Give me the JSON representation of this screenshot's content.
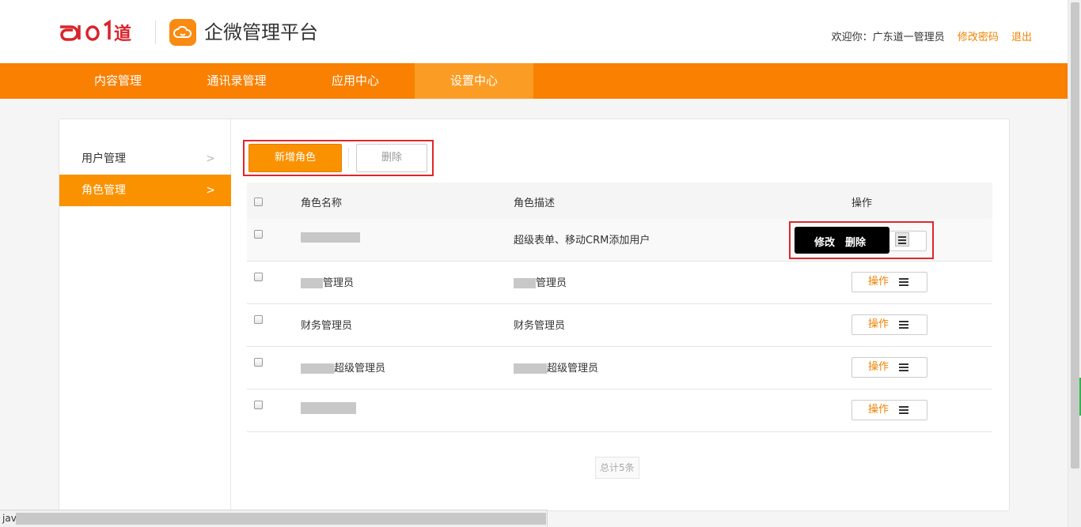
{
  "header": {
    "logo_text": "do1道",
    "app_title": "企微管理平台",
    "welcome": "欢迎你：广东道一管理员",
    "change_password": "修改密码",
    "logout": "退出"
  },
  "nav": {
    "tabs": [
      {
        "label": "内容管理"
      },
      {
        "label": "通讯录管理"
      },
      {
        "label": "应用中心"
      },
      {
        "label": "设置中心",
        "active": true
      }
    ]
  },
  "sidebar": {
    "items": [
      {
        "label": "用户管理",
        "active": false
      },
      {
        "label": "角色管理",
        "active": true
      }
    ]
  },
  "toolbar": {
    "add_label": "新增角色",
    "delete_label": "删除"
  },
  "table": {
    "headers": {
      "name": "角色名称",
      "desc": "角色描述",
      "op": "操作"
    },
    "rows": [
      {
        "name_suffix": "",
        "desc": "超级表单、移动CRM添加用户"
      },
      {
        "name_suffix": "管理员",
        "desc": "管理员"
      },
      {
        "name": "财务管理员",
        "desc": "财务管理员"
      },
      {
        "name_suffix": "超级管理员",
        "desc": "超级管理员"
      },
      {
        "name_suffix": "",
        "desc": ""
      }
    ],
    "op_label": "操作"
  },
  "popup": {
    "edit": "修改",
    "delete": "删除"
  },
  "footer": {
    "total": "总计5条"
  },
  "status_bar": {
    "text": "jav"
  },
  "colors": {
    "brand_orange": "#f98000",
    "active_orange": "#fa9200",
    "link_orange": "#f18200",
    "highlight_red": "#e0262d"
  }
}
